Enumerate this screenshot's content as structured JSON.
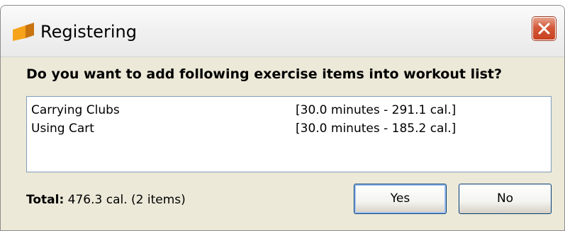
{
  "dialog": {
    "title": "Registering",
    "question": "Do you want to add following exercise items into workout list?",
    "items": [
      {
        "name": "Carrying Clubs",
        "detail": "[30.0 minutes - 291.1 cal.]"
      },
      {
        "name": "Using Cart",
        "detail": "[30.0 minutes - 185.2 cal.]"
      }
    ],
    "total_label": "Total:",
    "total_value": "476.3 cal. (2 items)",
    "yes_label": "Yes",
    "no_label": "No"
  },
  "icons": {
    "app": "app-icon",
    "close": "close-icon"
  },
  "colors": {
    "close_button": "#d4593a",
    "dialog_background": "#ece9d8",
    "default_button_focus": "#9dbff0"
  }
}
